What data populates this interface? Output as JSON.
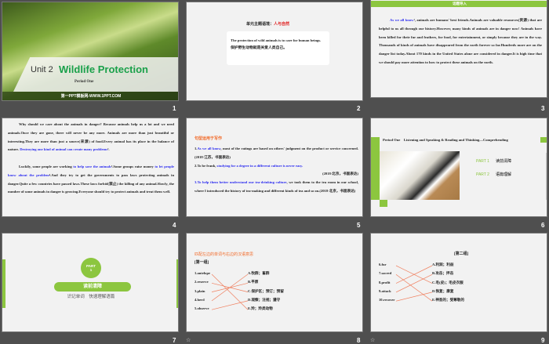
{
  "slides": [
    {
      "number": "1",
      "unit": "Unit 2",
      "title": "Wildlife Protection",
      "period": "Period One",
      "site": "第一PPT模板网-WWW.1PPT.COM"
    },
    {
      "number": "2",
      "heading_label": "单元主题语境：",
      "heading_value": "人与自然",
      "quote_en": "The protection of wild animals is to care for human beings.",
      "quote_cn": "保护野生动物就是关爱人类自己。"
    },
    {
      "number": "3",
      "header": "话题导入",
      "lead": "As we all know",
      "body": "¹, animals are humans' best friends.Animals are valuable resources(资源) that are helpful to us all through our history.However, many kinds of animals are in danger now! Animals have been killed for their fur and feathers, for food, for entertainment, or simply because they are in the way. Thousands of kinds of animals have disappeared from the earth forever so far.Hundreds more are on the danger list today.About 170 kinds in the United States alone are considered in danger.It is high time that we should pay more attention to how to protect these animals on the earth."
    },
    {
      "number": "4",
      "p1a": "Why should we care about the animals in danger? Because animals help us a lot and we need animals.Once they are gone, there will never be any more. Animals are more than just beautiful or interesting.They are more than just a source(来源) of food.Every animal has its place in the balance of nature. ",
      "p1b": "Destroying one kind of animal can create many problems",
      "p1c": "².",
      "p2a": "Luckily, some people are working ",
      "p2b": "to help save the animals",
      "p2c": "³.Some groups raise money ",
      "p2d": "to let people know about the problem",
      "p2e": "⁴.And they try to get the governments to pass laws protecting animals in danger.Quite a few countries have passed laws.These laws forbid(禁止) the killing of any animal.Slowly, the number of some animals in danger is growing.Everyone should try to protect animals and treat them well."
    },
    {
      "number": "5",
      "heading": "句型运用于写作",
      "i1a": "1.",
      "i1b": "As we all know",
      "i1c": ", most of the ratings are based on others' judgment on the product or service concerned.(2018·江苏，书面表达)",
      "i2a": "2.To be frank, ",
      "i2b": "studying for a degree in a different culture is never easy.",
      "i2c": "(2018·北京，书面表达)",
      "i3a": "3.",
      "i3b": "To help them better understand our tea-drinking culture",
      "i3c": ", we took them to the tea room in our school, where I introduced the history of tea-making and different kinds of tea and so on.(2018·北京，书面表达)"
    },
    {
      "number": "6",
      "title": "Period One　Listening and Speaking & Reading and Thinking—Comprehending",
      "parts": [
        {
          "label": "PART 1",
          "text": "读前清障"
        },
        {
          "label": "PART 2",
          "text": "语篇理解"
        }
      ]
    },
    {
      "number": "7",
      "part": "PART",
      "part_num": "1",
      "pill": "读前清障",
      "sub": "识记单词　快速理解语篇"
    },
    {
      "number": "8",
      "heading": "匹配左边的单词与右边的汉语意思",
      "group": "[第一组]",
      "left": [
        "1.antelope",
        "2.reserve",
        "3.plain",
        "4.herd",
        "5.observe"
      ],
      "right": [
        "A.牧群；畜群",
        "B.平原",
        "C.保护区；预订；预留",
        "D.观察；注视；遵守",
        "E.羚；羚类动物"
      ],
      "matches": [
        4,
        2,
        1,
        0,
        3
      ]
    },
    {
      "number": "9",
      "group": "[第二组]",
      "left": [
        "6.fur",
        "7.sacred",
        "8.profit",
        "9.attack",
        "10.recover"
      ],
      "right": [
        "A.利润；利益",
        "B.攻击；抨击",
        "C.毛(皮)；毛皮衣服",
        "D.恢复；康复",
        "E.神圣的；受尊敬的"
      ],
      "matches": [
        2,
        4,
        0,
        1,
        3
      ]
    }
  ],
  "colors": {
    "accent_green": "#8cc63f",
    "title_green": "#1aa04a",
    "link_blue": "#2b2bf0",
    "heading_orange": "#f26b2a",
    "line_orange": "#f08060"
  }
}
